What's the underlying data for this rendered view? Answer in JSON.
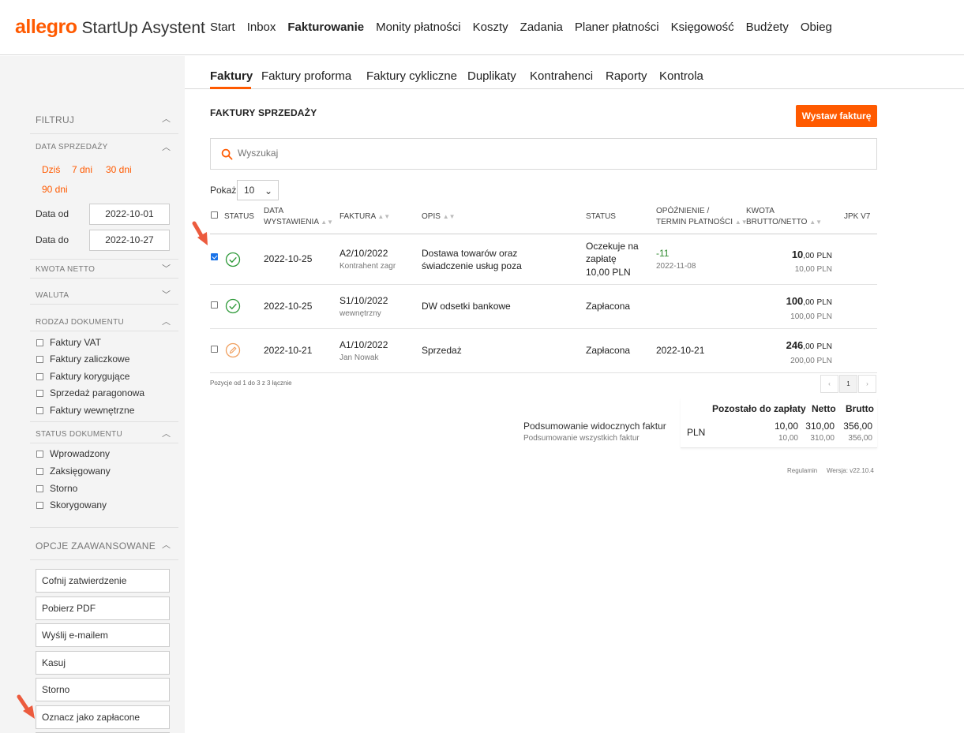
{
  "brand": {
    "name": "allegro",
    "product": "StartUp Asystent"
  },
  "topnav": [
    {
      "label": "Start",
      "active": false
    },
    {
      "label": "Inbox",
      "active": false
    },
    {
      "label": "Fakturowanie",
      "active": true
    },
    {
      "label": "Monity płatności",
      "active": false
    },
    {
      "label": "Koszty",
      "active": false
    },
    {
      "label": "Zadania",
      "active": false
    },
    {
      "label": "Planer płatności",
      "active": false
    },
    {
      "label": "Księgowość",
      "active": false
    },
    {
      "label": "Budżety",
      "active": false
    },
    {
      "label": "Obieg",
      "active": false
    }
  ],
  "subnav": [
    {
      "label": "Faktury",
      "active": true
    },
    {
      "label": "Faktury proforma",
      "active": false
    },
    {
      "label": "Faktury cykliczne",
      "active": false
    },
    {
      "label": "Duplikaty",
      "active": false
    },
    {
      "label": "Kontrahenci",
      "active": false
    },
    {
      "label": "Raporty",
      "active": false
    },
    {
      "label": "Kontrola",
      "active": false
    }
  ],
  "sidebar": {
    "filter_title": "FILTRUJ",
    "date_section": "DATA SPRZEDAŻY",
    "quick_ranges": [
      "Dziś",
      "7 dni",
      "30 dni",
      "90 dni"
    ],
    "date_from_label": "Data od",
    "date_from": "2022-10-01",
    "date_to_label": "Data do",
    "date_to": "2022-10-27",
    "net_amount": "KWOTA NETTO",
    "currency": "WALUTA",
    "doc_type_title": "RODZAJ DOKUMENTU",
    "doc_types": [
      "Faktury VAT",
      "Faktury zaliczkowe",
      "Faktury korygujące",
      "Sprzedaż paragonowa",
      "Faktury wewnętrzne"
    ],
    "doc_status_title": "STATUS DOKUMENTU",
    "doc_statuses": [
      "Wprowadzony",
      "Zaksięgowany",
      "Storno",
      "Skorygowany"
    ],
    "advanced_title": "OPCJE ZAAWANSOWANE",
    "advanced_actions": [
      "Cofnij zatwierdzenie",
      "Pobierz PDF",
      "Wyślij e-mailem",
      "Kasuj",
      "Storno",
      "Oznacz jako zapłacone"
    ]
  },
  "page": {
    "title": "FAKTURY SPRZEDAŻY",
    "new_invoice": "Wystaw fakturę",
    "search_placeholder": "Wyszukaj",
    "show_label": "Pokaż",
    "show_value": "10"
  },
  "table": {
    "headers": {
      "status": "STATUS",
      "date_1": "DATA",
      "date_2": "WYSTAWIENIA",
      "invoice": "FAKTURA",
      "desc": "OPIS",
      "status2": "STATUS",
      "delay_1": "OPÓŹNIENIE /",
      "delay_2": "TERMIN PŁATNOŚCI",
      "amount_1": "KWOTA",
      "amount_2": "BRUTTO/NETTO",
      "jpk": "JPK V7"
    },
    "rows": [
      {
        "checked": true,
        "status_icon": "check-circle-icon",
        "date": "2022-10-25",
        "number": "A2/10/2022",
        "contractor": "Kontrahent zagr",
        "desc_1": "Dostawa towarów oraz",
        "desc_2": "świadczenie usług poza",
        "status_1": "Oczekuje na",
        "status_2": "zapłatę",
        "status_3": "10,00 PLN",
        "delay": "-11",
        "due": "2022-11-08",
        "gross_int": "10",
        "gross_dec": ",00",
        "currency": "PLN",
        "net": "10,00 PLN"
      },
      {
        "checked": false,
        "status_icon": "check-circle-icon",
        "date": "2022-10-25",
        "number": "S1/10/2022",
        "contractor": "wewnętrzny",
        "desc_1": "DW odsetki bankowe",
        "desc_2": "",
        "status_1": "Zapłacona",
        "status_2": "",
        "status_3": "",
        "delay": "",
        "due": "",
        "gross_int": "100",
        "gross_dec": ",00",
        "currency": "PLN",
        "net": "100,00 PLN"
      },
      {
        "checked": false,
        "status_icon": "pencil-circle-icon",
        "date": "2022-10-21",
        "number": "A1/10/2022",
        "contractor": "Jan Nowak",
        "desc_1": "Sprzedaż",
        "desc_2": "",
        "status_1": "Zapłacona",
        "status_2": "",
        "status_3": "",
        "delay": "",
        "due": "2022-10-21",
        "gross_int": "246",
        "gross_dec": ",00",
        "currency": "PLN",
        "net": "200,00 PLN"
      }
    ],
    "position_text": "Pozycje od 1 do 3 z 3 łącznie",
    "pager": {
      "prev": "‹",
      "page": "1",
      "next": "›"
    }
  },
  "summary": {
    "visible_label": "Podsumowanie widocznych faktur",
    "all_label": "Podsumowanie wszystkich faktur",
    "col_remaining": "Pozostało do zapłaty",
    "col_net": "Netto",
    "col_gross": "Brutto",
    "currency": "PLN",
    "visible": {
      "remaining": "10,00",
      "net": "310,00",
      "gross": "356,00"
    },
    "all": {
      "remaining": "10,00",
      "net": "310,00",
      "gross": "356,00"
    }
  },
  "footer": {
    "terms": "Regulamin",
    "version": "Wersja: v22.10.4"
  },
  "colors": {
    "accent": "#ff5a00",
    "success": "#2f9a3a",
    "edit": "#f0a060",
    "annotation_arrow": "#ec5b3e"
  }
}
